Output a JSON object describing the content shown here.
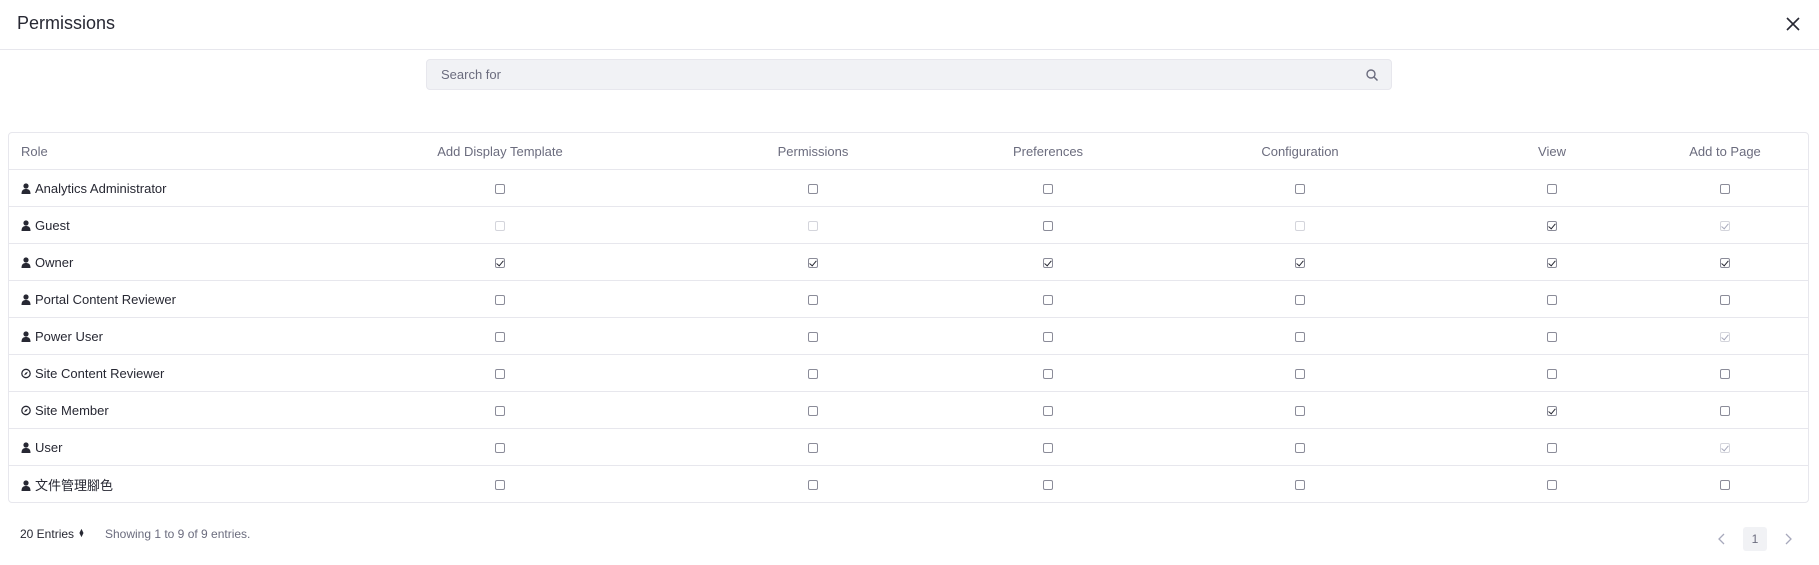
{
  "modal": {
    "title": "Permissions"
  },
  "search": {
    "placeholder": "Search for"
  },
  "table": {
    "headers": [
      "Role",
      "Add Display Template",
      "Permissions",
      "Preferences",
      "Configuration",
      "View",
      "Add to Page"
    ],
    "rows": [
      {
        "role": "Analytics Administrator",
        "icon": "user-icon",
        "perms": [
          0,
          0,
          0,
          0,
          0,
          0
        ],
        "disabled": [
          0,
          0,
          0,
          0,
          0,
          0
        ]
      },
      {
        "role": "Guest",
        "icon": "user-icon",
        "perms": [
          0,
          0,
          0,
          0,
          1,
          1
        ],
        "disabled": [
          1,
          1,
          0,
          1,
          0,
          1
        ]
      },
      {
        "role": "Owner",
        "icon": "user-icon",
        "perms": [
          1,
          1,
          1,
          1,
          1,
          1
        ],
        "disabled": [
          0,
          0,
          0,
          0,
          0,
          0
        ]
      },
      {
        "role": "Portal Content Reviewer",
        "icon": "user-icon",
        "perms": [
          0,
          0,
          0,
          0,
          0,
          0
        ],
        "disabled": [
          0,
          0,
          0,
          0,
          0,
          0
        ]
      },
      {
        "role": "Power User",
        "icon": "user-icon",
        "perms": [
          0,
          0,
          0,
          0,
          0,
          1
        ],
        "disabled": [
          0,
          0,
          0,
          0,
          0,
          1
        ]
      },
      {
        "role": "Site Content Reviewer",
        "icon": "compass-icon",
        "perms": [
          0,
          0,
          0,
          0,
          0,
          0
        ],
        "disabled": [
          0,
          0,
          0,
          0,
          0,
          0
        ]
      },
      {
        "role": "Site Member",
        "icon": "compass-icon",
        "perms": [
          0,
          0,
          0,
          0,
          1,
          0
        ],
        "disabled": [
          0,
          0,
          0,
          0,
          0,
          0
        ]
      },
      {
        "role": "User",
        "icon": "user-icon",
        "perms": [
          0,
          0,
          0,
          0,
          0,
          1
        ],
        "disabled": [
          0,
          0,
          0,
          0,
          0,
          1
        ]
      },
      {
        "role": "文件管理腳色",
        "icon": "user-icon",
        "perms": [
          0,
          0,
          0,
          0,
          0,
          0
        ],
        "disabled": [
          0,
          0,
          0,
          0,
          0,
          0
        ]
      }
    ]
  },
  "footer": {
    "entries_label": "20 Entries",
    "showing_text": "Showing 1 to 9 of 9 entries.",
    "current_page": "1"
  }
}
